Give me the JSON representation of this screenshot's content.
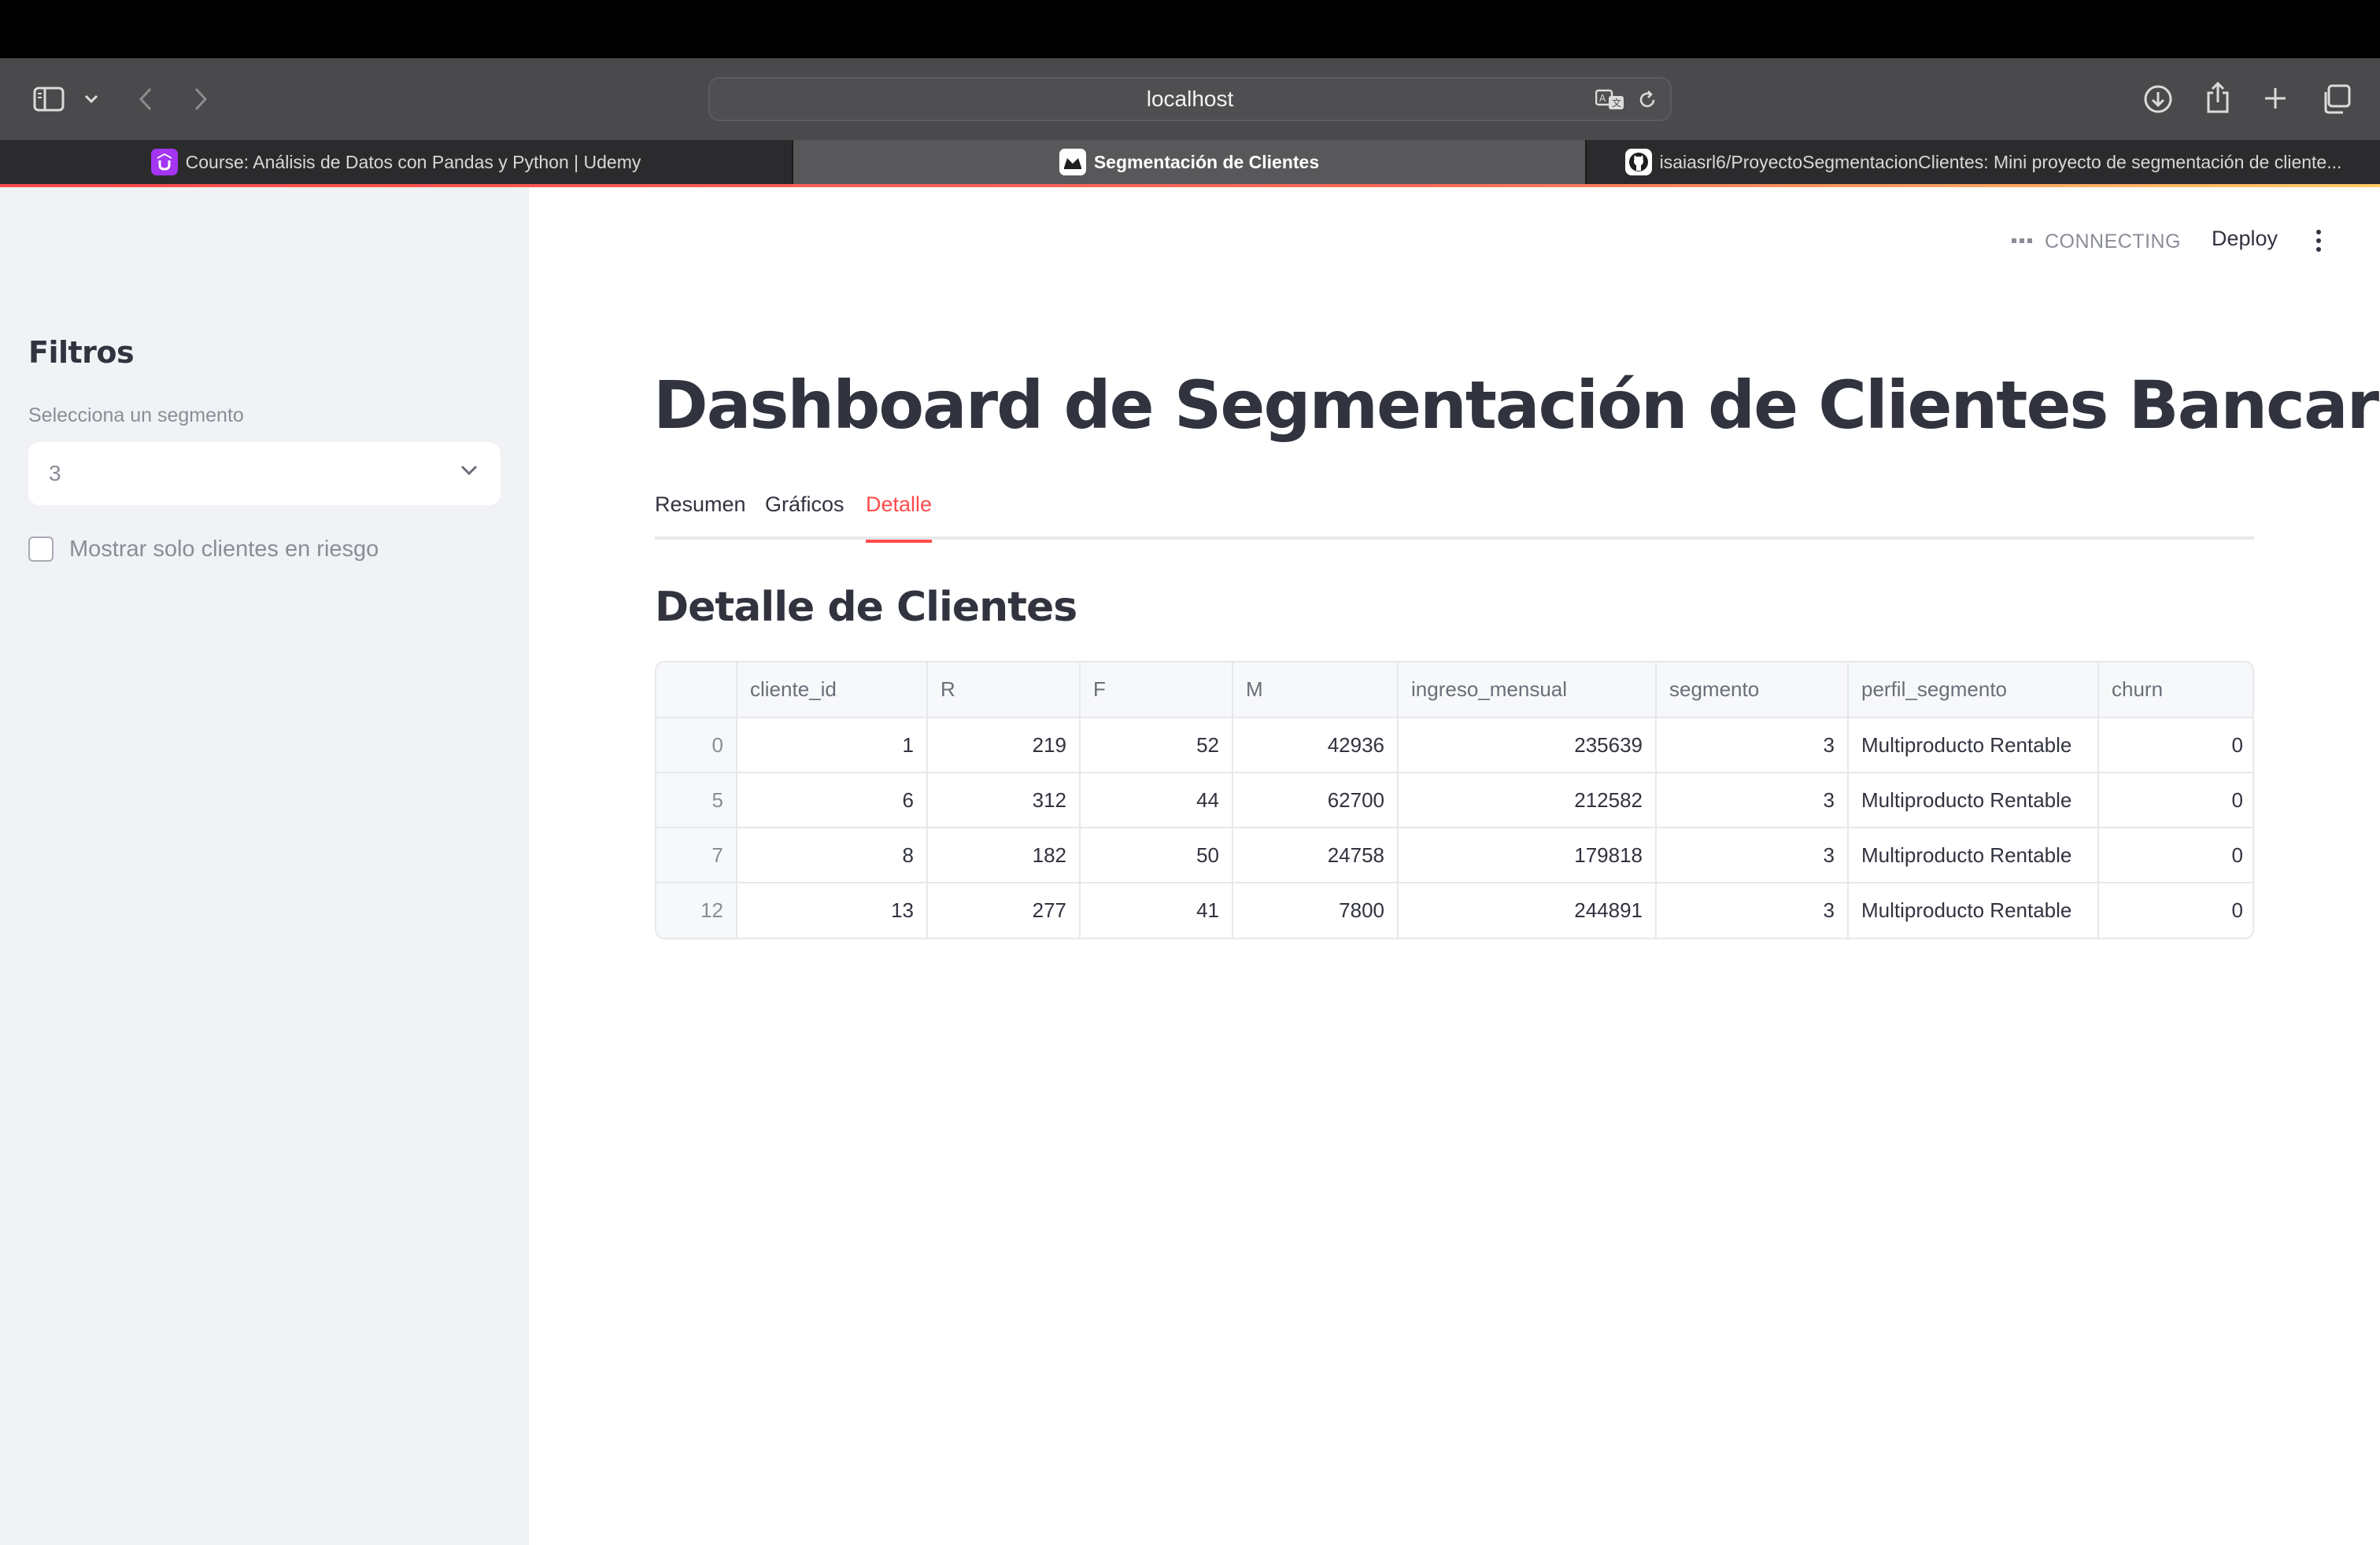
{
  "browser": {
    "address": "localhost",
    "tabs": [
      {
        "label": "Course: Análisis de Datos con Pandas y Python | Udemy",
        "active": false,
        "favicon": "udemy-icon"
      },
      {
        "label": "Segmentación de Clientes",
        "active": true,
        "favicon": "streamlit-icon"
      },
      {
        "label": "isaiasrl6/ProyectoSegmentacionClientes: Mini proyecto de segmentación de cliente...",
        "active": false,
        "favicon": "github-icon"
      }
    ]
  },
  "sidebar": {
    "title": "Filtros",
    "segment_label": "Selecciona un segmento",
    "segment_value": "3",
    "risk_checkbox_label": "Mostrar solo clientes en riesgo",
    "risk_checked": false
  },
  "header": {
    "status": "CONNECTING",
    "deploy_label": "Deploy"
  },
  "main": {
    "title": "Dashboard de Segmentación de Clientes Bancarios",
    "tabs": [
      {
        "label": "Resumen",
        "active": false
      },
      {
        "label": "Gráficos",
        "active": false
      },
      {
        "label": "Detalle",
        "active": true
      }
    ],
    "section_title": "Detalle de Clientes",
    "table": {
      "columns": [
        "",
        "cliente_id",
        "R",
        "F",
        "M",
        "ingreso_mensual",
        "segmento",
        "perfil_segmento",
        "churn"
      ],
      "rows": [
        [
          "0",
          "1",
          "219",
          "52",
          "42936",
          "235639",
          "3",
          "Multiproducto Rentable",
          "0"
        ],
        [
          "5",
          "6",
          "312",
          "44",
          "62700",
          "212582",
          "3",
          "Multiproducto Rentable",
          "0"
        ],
        [
          "7",
          "8",
          "182",
          "50",
          "24758",
          "179818",
          "3",
          "Multiproducto Rentable",
          "0"
        ],
        [
          "12",
          "13",
          "277",
          "41",
          "7800",
          "244891",
          "3",
          "Multiproducto Rentable",
          "0"
        ]
      ]
    }
  },
  "colors": {
    "accent": "#ff4b4b",
    "sidebar_bg": "#f0f2f6",
    "text": "#31333f"
  }
}
